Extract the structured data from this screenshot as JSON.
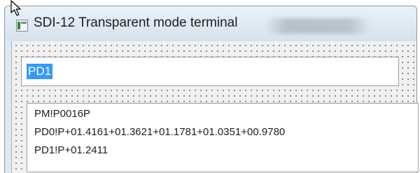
{
  "window": {
    "title": "SDI-12 Transparent mode terminal",
    "icon": "app-icon"
  },
  "command_input": {
    "value": "PD1",
    "selected": true
  },
  "output": {
    "lines": [
      "PM!P0016P",
      "PD0!P+01.4161+01.3621+01.1781+01.0351+00.9780",
      "PD1!P+01.2411"
    ]
  },
  "colors": {
    "selection": "#3399ff",
    "dialog_background": "#f0f0f0",
    "grid_dots": "#6f6f6f"
  }
}
